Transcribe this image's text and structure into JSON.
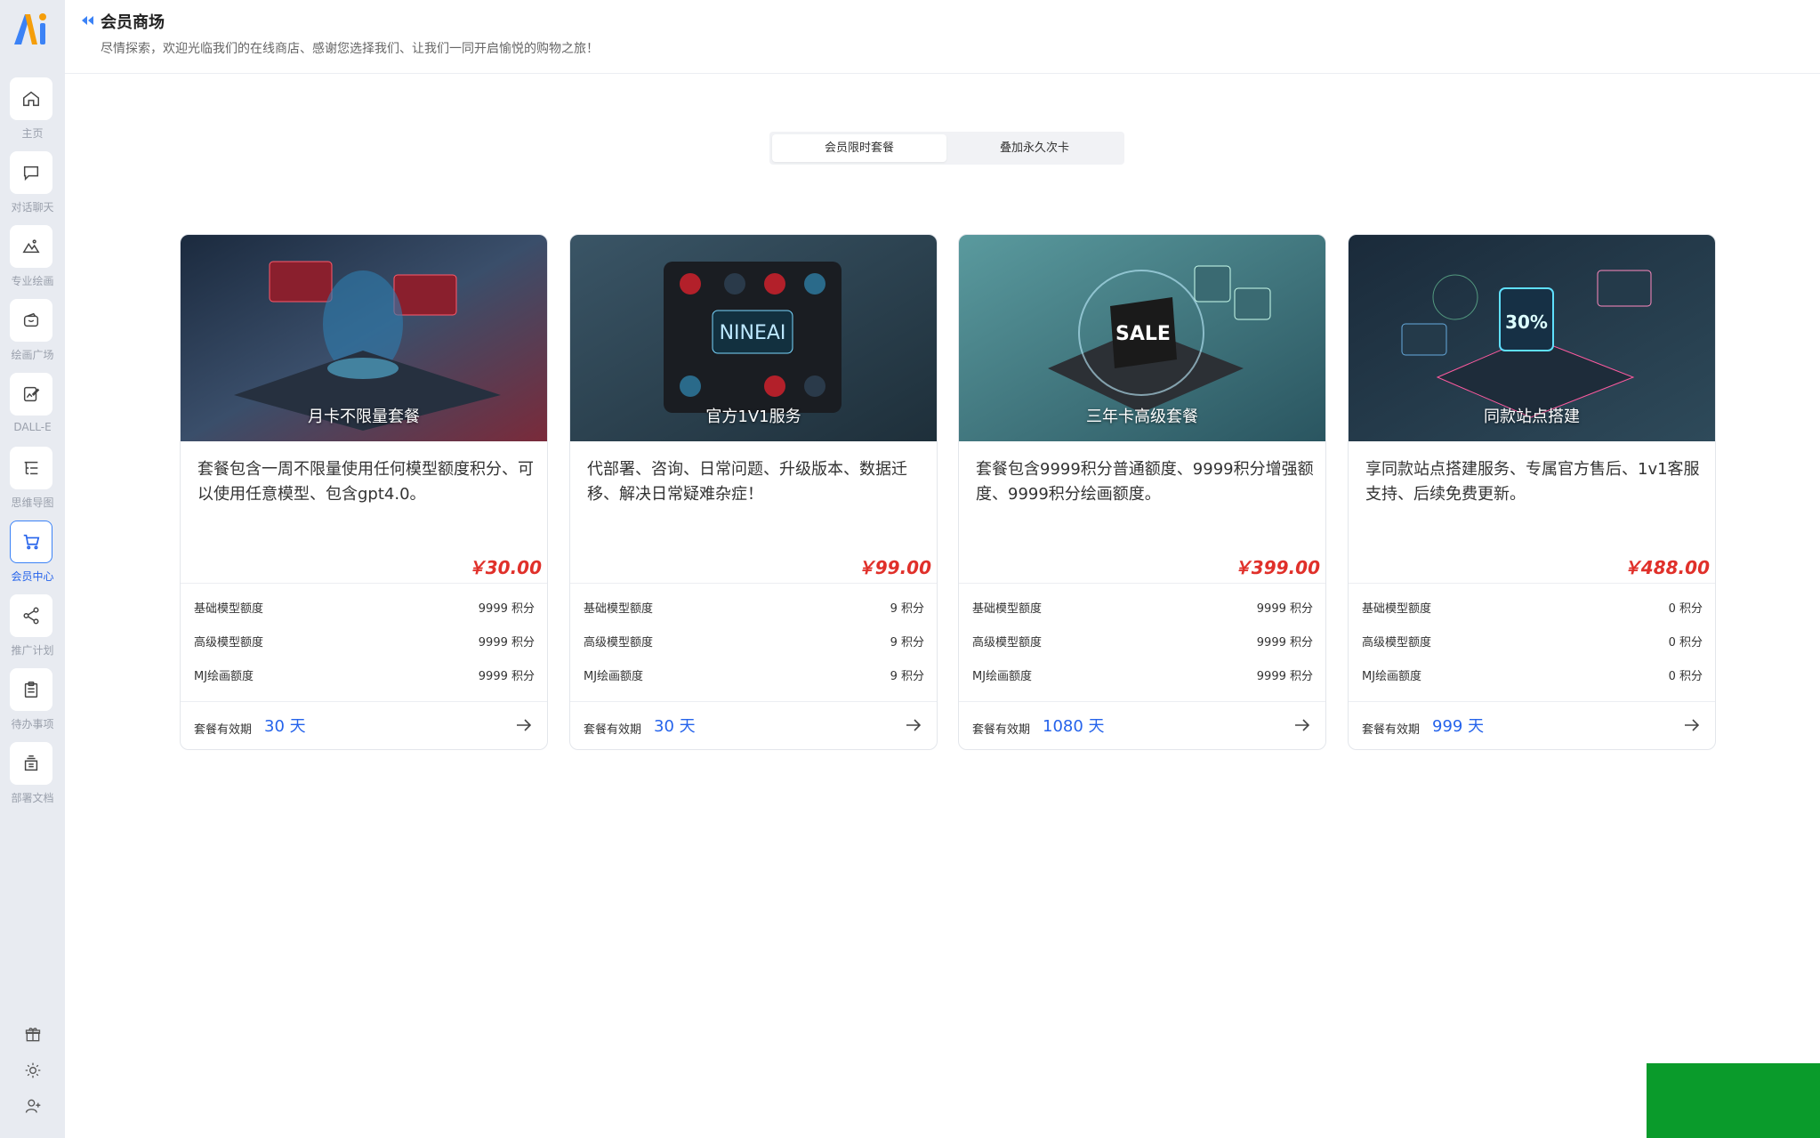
{
  "sidebar": {
    "items": [
      {
        "label": "主页",
        "icon": "home-icon"
      },
      {
        "label": "对话聊天",
        "icon": "chat-icon"
      },
      {
        "label": "专业绘画",
        "icon": "image-icon"
      },
      {
        "label": "绘画广场",
        "icon": "wallet-icon"
      },
      {
        "label": "DALL-E",
        "icon": "edit-image-icon"
      },
      {
        "label": "思维导图",
        "icon": "mindmap-icon"
      },
      {
        "label": "会员中心",
        "icon": "cart-icon",
        "active": true
      },
      {
        "label": "推广计划",
        "icon": "share-icon"
      },
      {
        "label": "待办事项",
        "icon": "clipboard-icon"
      },
      {
        "label": "部署文档",
        "icon": "archive-icon"
      }
    ],
    "bottom_icons": [
      "gift-icon",
      "sun-icon",
      "user-add-icon"
    ]
  },
  "header": {
    "title": "会员商场",
    "subtitle": "尽情探索，欢迎光临我们的在线商店、感谢您选择我们、让我们一同开启愉悦的购物之旅！"
  },
  "tabs": [
    "会员限时套餐",
    "叠加永久次卡"
  ],
  "cards": [
    {
      "image_title": "月卡不限量套餐",
      "description": "套餐包含一周不限量使用任何模型额度积分、可以使用任意模型、包含gpt4.0。",
      "price": "￥30.00",
      "quotas": [
        {
          "label": "基础模型额度",
          "value": "9999 积分"
        },
        {
          "label": "高级模型额度",
          "value": "9999 积分"
        },
        {
          "label": "MJ绘画额度",
          "value": "9999 积分"
        }
      ],
      "valid_label": "套餐有效期",
      "valid_days": "30 天"
    },
    {
      "image_title": "官方1V1服务",
      "description": "代部署、咨询、日常问题、升级版本、数据迁移、解决日常疑难杂症！",
      "price": "￥99.00",
      "quotas": [
        {
          "label": "基础模型额度",
          "value": "9 积分"
        },
        {
          "label": "高级模型额度",
          "value": "9 积分"
        },
        {
          "label": "MJ绘画额度",
          "value": "9 积分"
        }
      ],
      "valid_label": "套餐有效期",
      "valid_days": "30 天"
    },
    {
      "image_title": "三年卡高级套餐",
      "description": "套餐包含9999积分普通额度、9999积分增强额度、9999积分绘画额度。",
      "price": "￥399.00",
      "quotas": [
        {
          "label": "基础模型额度",
          "value": "9999 积分"
        },
        {
          "label": "高级模型额度",
          "value": "9999 积分"
        },
        {
          "label": "MJ绘画额度",
          "value": "9999 积分"
        }
      ],
      "valid_label": "套餐有效期",
      "valid_days": "1080 天"
    },
    {
      "image_title": "同款站点搭建",
      "description": "享同款站点搭建服务、专属官方售后、1v1客服支持、后续免费更新。",
      "price": "￥488.00",
      "quotas": [
        {
          "label": "基础模型额度",
          "value": "0 积分"
        },
        {
          "label": "高级模型额度",
          "value": "0 积分"
        },
        {
          "label": "MJ绘画额度",
          "value": "0 积分"
        }
      ],
      "valid_label": "套餐有效期",
      "valid_days": "999 天"
    }
  ],
  "colors": {
    "accent": "#2563eb",
    "price": "#e0302a",
    "sidebar_bg": "#e8ebf1",
    "corner_block": "#0a9b2b"
  }
}
